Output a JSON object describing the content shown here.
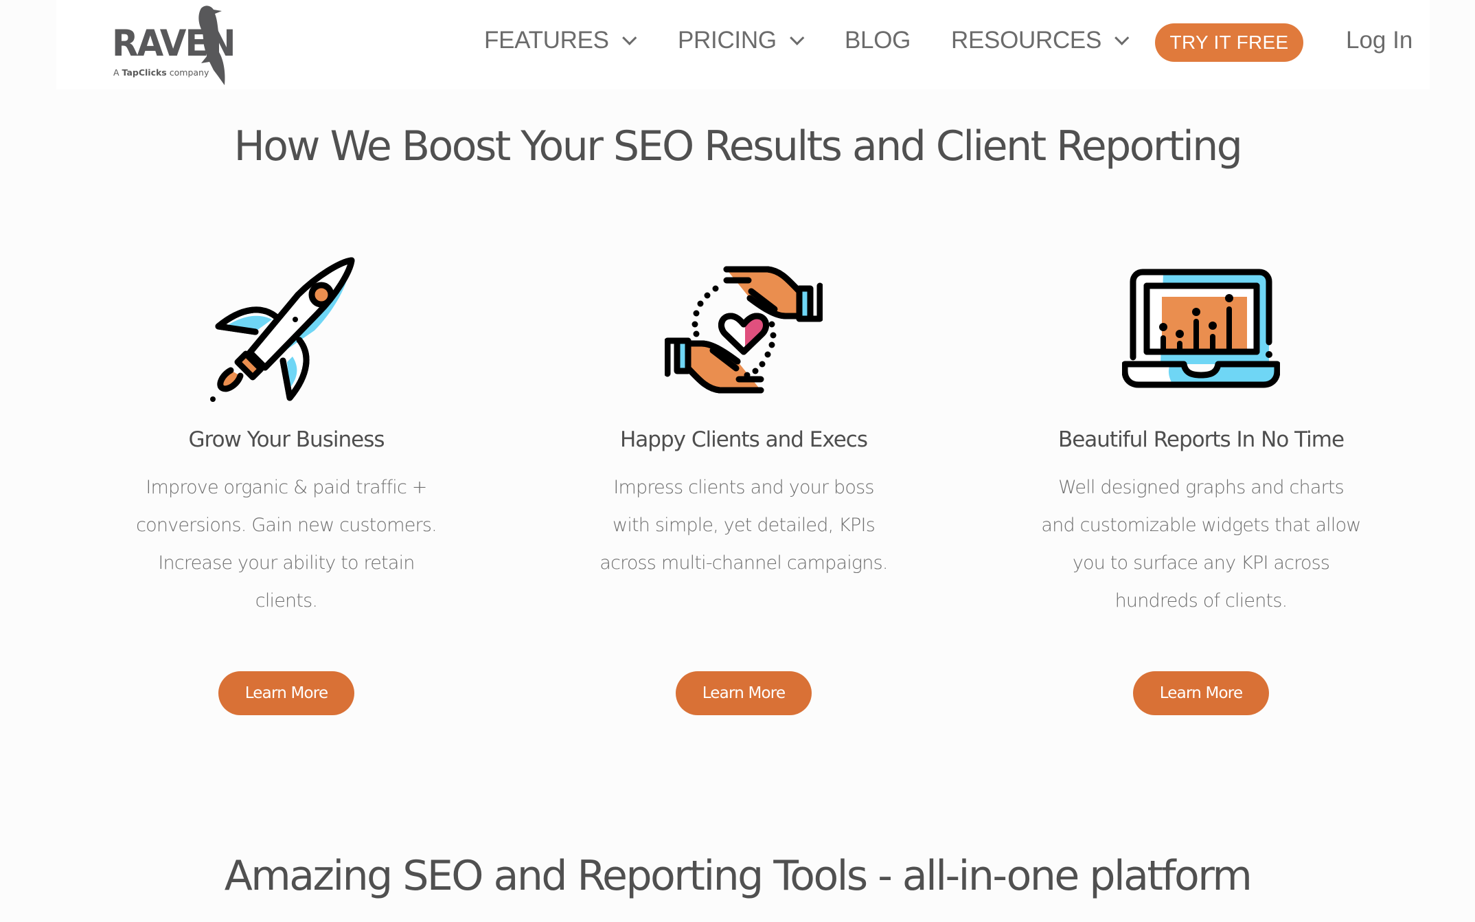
{
  "brand": {
    "name": "RAVEN",
    "tagline_prefix": "A",
    "tagline_company": "TapClicks",
    "tagline_suffix": "company"
  },
  "nav": {
    "items": [
      {
        "label": "FEATURES",
        "has_dropdown": true
      },
      {
        "label": "PRICING",
        "has_dropdown": true
      },
      {
        "label": "BLOG",
        "has_dropdown": false
      },
      {
        "label": "RESOURCES",
        "has_dropdown": true
      }
    ],
    "cta_label": "TRY IT FREE",
    "login_label": "Log In"
  },
  "main": {
    "heading": "How We Boost Your SEO Results and Client Reporting",
    "features": [
      {
        "icon": "rocket-icon",
        "title": "Grow Your Business",
        "description_lines": [
          "Improve organic & paid traffic +",
          "conversions. Gain new customers.",
          "Increase your ability to retain",
          "clients."
        ],
        "button_label": "Learn More"
      },
      {
        "icon": "hands-heart-icon",
        "title": "Happy Clients and Execs",
        "description_lines": [
          "Impress clients and your boss",
          "with simple, yet detailed, KPIs",
          "across multi-channel campaigns."
        ],
        "button_label": "Learn More"
      },
      {
        "icon": "laptop-chart-icon",
        "title": "Beautiful Reports In No Time",
        "description_lines": [
          "Well designed graphs and charts",
          "and customizable widgets that allow",
          "you to surface any KPI across",
          "hundreds of clients."
        ],
        "button_label": "Learn More"
      }
    ],
    "bottom_heading": "Amazing SEO and Reporting Tools - all-in-one platform"
  },
  "colors": {
    "accent_orange": "#e07a3c",
    "button_orange": "#d97136",
    "icon_blue": "#6fd6f5",
    "icon_orange": "#ea8e4f",
    "icon_pink": "#e0507e",
    "text_dark": "#505050",
    "text_muted": "#6e6e6e"
  }
}
